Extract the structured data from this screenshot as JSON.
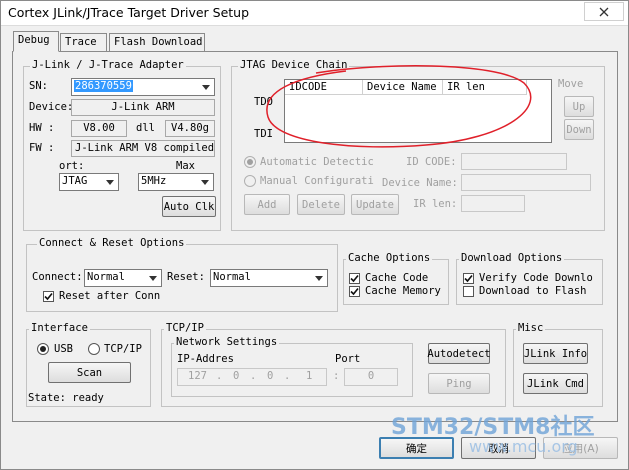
{
  "window": {
    "title": "Cortex JLink/JTrace Target Driver Setup"
  },
  "tabs": [
    {
      "label": "Debug"
    },
    {
      "label": "Trace"
    },
    {
      "label": "Flash Download"
    }
  ],
  "adapter": {
    "group_label": "J-Link / J-Trace Adapter",
    "sn_label": "SN:",
    "sn_value": "286370559",
    "device_label": "Device:",
    "device_value": "J-Link ARM",
    "hw_label": "HW :",
    "hw_value": "V8.00",
    "dll_label": "dll",
    "dll_value": "V4.80g",
    "fw_label": "FW :",
    "fw_value": "J-Link ARM V8 compiled I",
    "port_label": "ort:",
    "max_label": "Max",
    "port_value": "JTAG",
    "max_value": "5MHz",
    "autoclk_label": "Auto Clk"
  },
  "jtag": {
    "group_label": "JTAG Device Chain",
    "columns": [
      "IDCODE",
      "Device Name",
      "IR len"
    ],
    "tdo_label": "TDO",
    "tdi_label": "TDI",
    "move_label": "Move",
    "up_label": "Up",
    "down_label": "Down",
    "auto_label": "Automatic Detectic",
    "manual_label": "Manual Configurati",
    "idcode_label": "ID CODE:",
    "devname_label": "Device Name:",
    "irlen_label": "IR len:",
    "add_label": "Add",
    "delete_label": "Delete",
    "update_label": "Update"
  },
  "connect": {
    "group_label": "Connect & Reset Options",
    "connect_label": "Connect:",
    "connect_value": "Normal",
    "reset_label": "Reset:",
    "reset_value": "Normal",
    "reset_after_label": "Reset after Conn"
  },
  "cache": {
    "group_label": "Cache Options",
    "code_label": "Cache Code",
    "memory_label": "Cache Memory"
  },
  "download": {
    "group_label": "Download Options",
    "verify_label": "Verify Code Downlo",
    "flash_label": "Download to Flash"
  },
  "interface": {
    "group_label": "Interface",
    "usb_label": "USB",
    "tcpip_label": "TCP/IP",
    "scan_label": "Scan",
    "state_label": "State: ready"
  },
  "tcpip": {
    "group_label": "TCP/IP",
    "net_label": "Network Settings",
    "ip_label": "IP-Addres",
    "port_label": "Port",
    "ip": [
      "127",
      ".",
      "0",
      ".",
      "0",
      ".",
      "1"
    ],
    "port_sep": ":",
    "port_value": "0",
    "autodetect_label": "Autodetect",
    "ping_label": "Ping"
  },
  "misc": {
    "group_label": "Misc",
    "info_label": "JLink Info",
    "cmd_label": "JLink Cmd"
  },
  "footer": {
    "ok_label": "确定",
    "cancel_label": "取消",
    "apply_label": "应用(A)"
  },
  "watermark": {
    "text": "STM32/STM8社区",
    "sub": "www.mcu.org"
  },
  "colors": {
    "annotation": "#e0202a",
    "watermark": "#6fa3d8",
    "selection": "#3399ff"
  }
}
